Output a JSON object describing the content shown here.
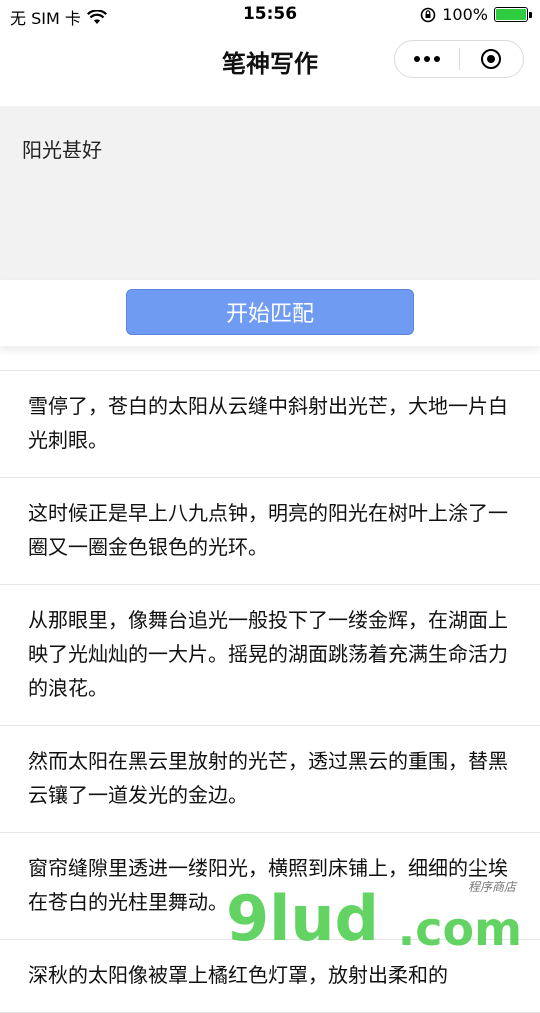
{
  "status_bar": {
    "carrier": "无 SIM 卡",
    "time": "15:56",
    "battery": "100%"
  },
  "nav": {
    "title": "笔神写作"
  },
  "search": {
    "value": "阳光甚好",
    "button_label": "开始匹配"
  },
  "results": [
    "雪停了，苍白的太阳从云缝中斜射出光芒，大地一片白光刺眼。",
    "这时候正是早上八九点钟，明亮的阳光在树叶上涂了一圈又一圈金色银色的光环。",
    "从那眼里，像舞台追光一般投下了一缕金辉，在湖面上映了光灿灿的一大片。摇晃的湖面跳荡着充满生命活力的浪花。",
    "然而太阳在黑云里放射的光芒，透过黑云的重围，替黑云镶了一道发光的金边。",
    "窗帘缝隙里透进一缕阳光，横照到床铺上，细细的尘埃在苍白的光柱里舞动。",
    "深秋的太阳像被罩上橘红色灯罩，放射出柔和的"
  ],
  "watermark": {
    "main": "9lud",
    "suffix": ".com",
    "small": "程序商店"
  }
}
